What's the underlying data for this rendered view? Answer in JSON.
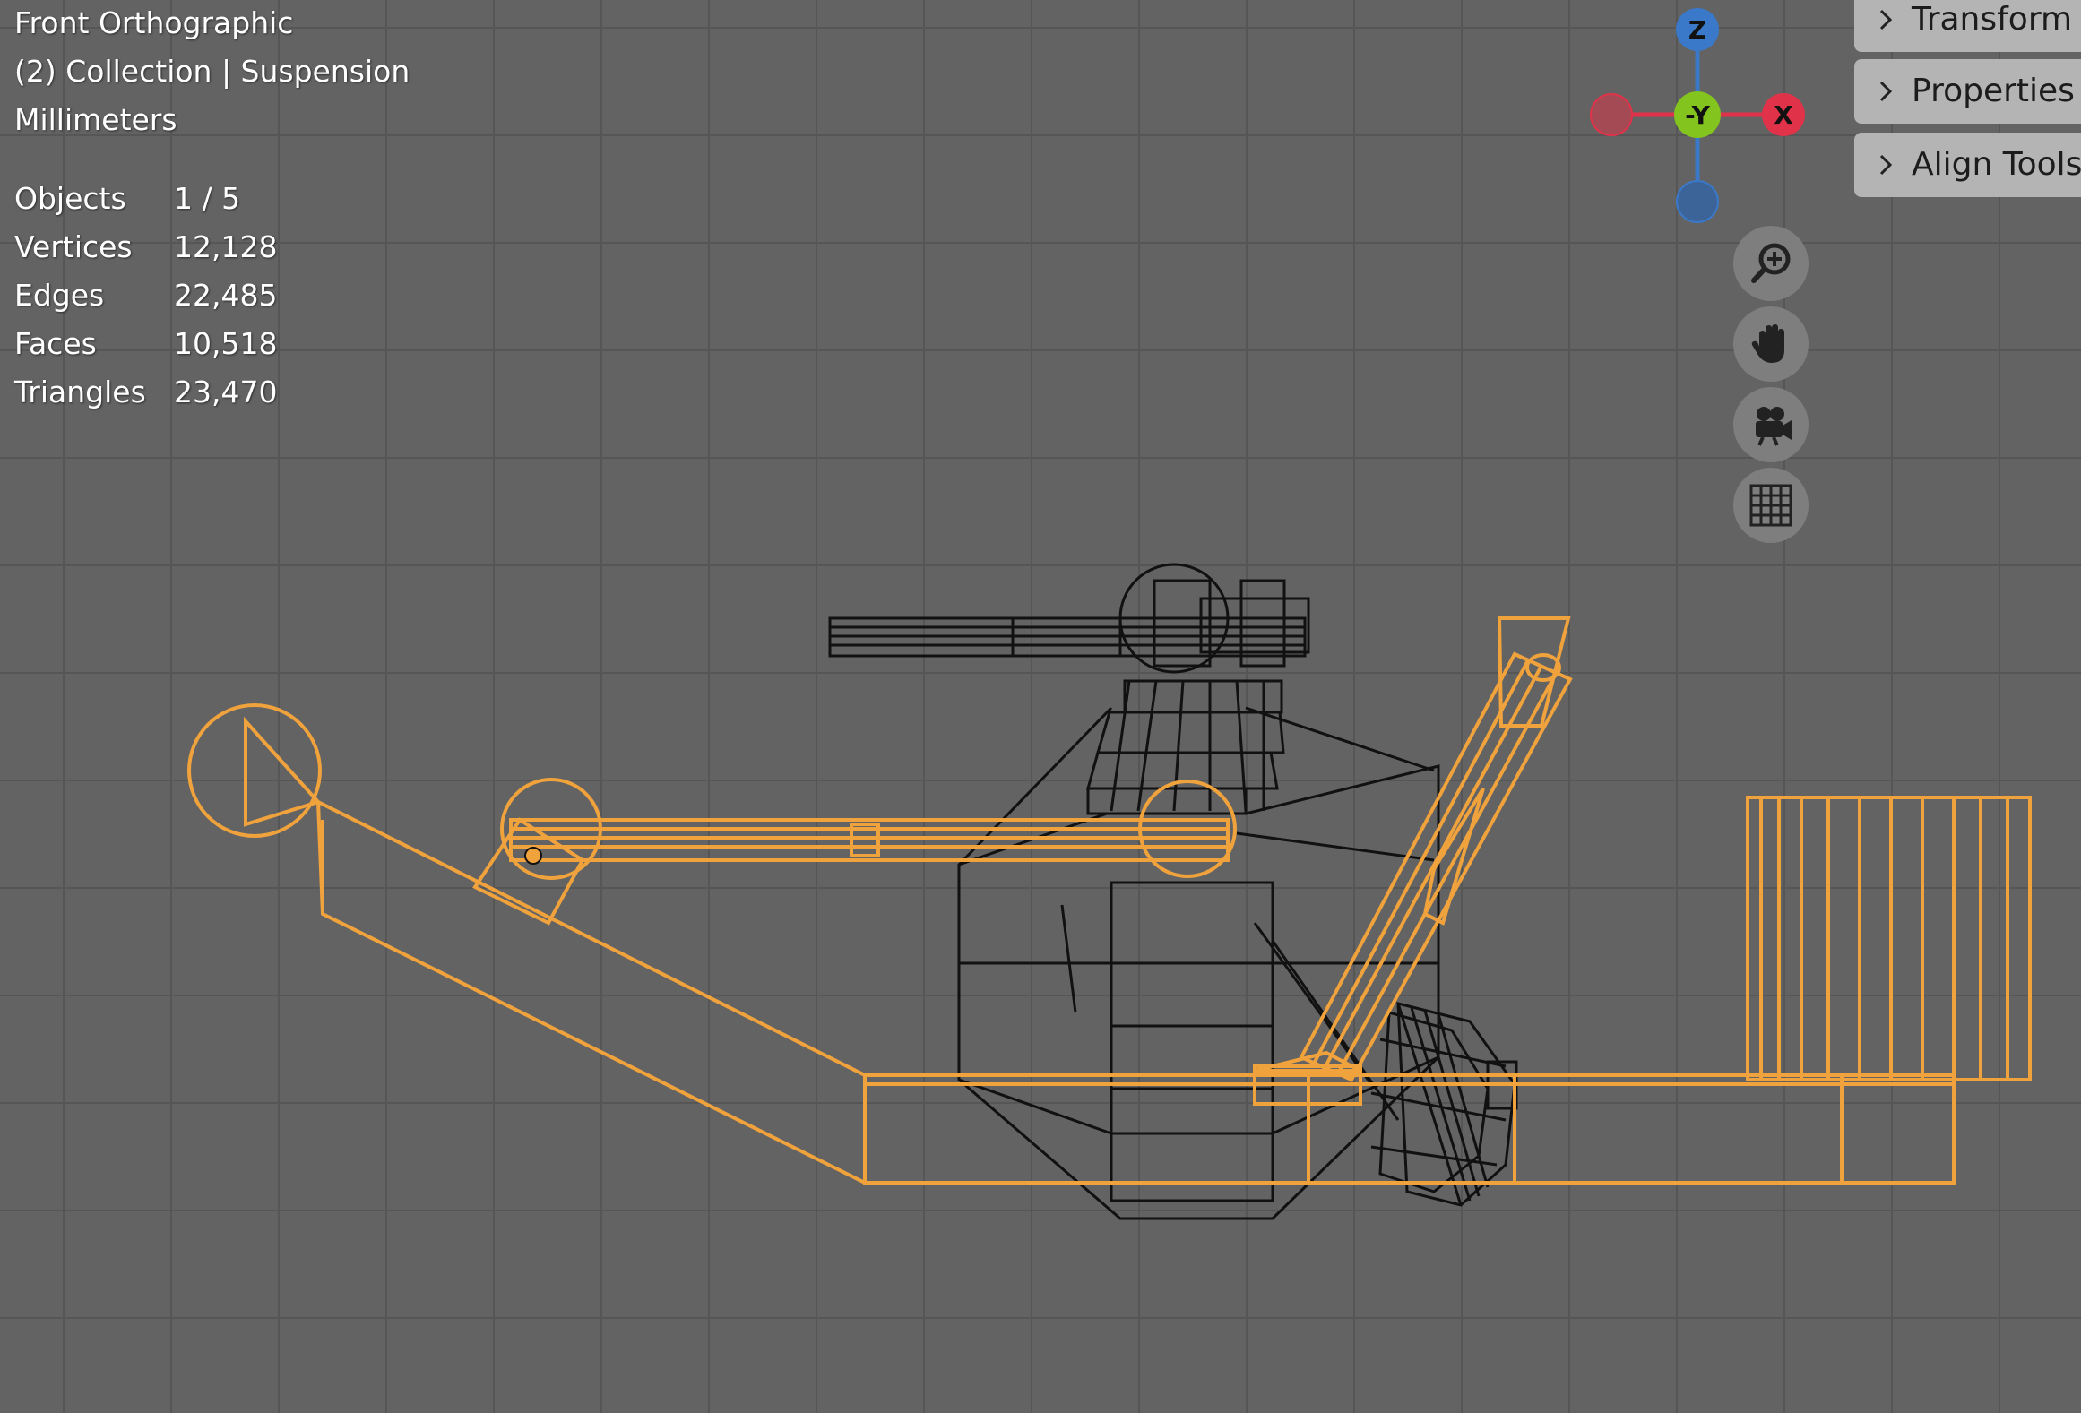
{
  "viewport": {
    "view_name": "Front Orthographic",
    "collection_info": "(2) Collection | Suspension",
    "units": "Millimeters"
  },
  "stats": [
    {
      "label": "Objects",
      "value": "1 / 5"
    },
    {
      "label": "Vertices",
      "value": "12,128"
    },
    {
      "label": "Edges",
      "value": "22,485"
    },
    {
      "label": "Faces",
      "value": "10,518"
    },
    {
      "label": "Triangles",
      "value": "23,470"
    }
  ],
  "sidebar_tabs": [
    {
      "label": "Transform"
    },
    {
      "label": "Properties"
    },
    {
      "label": "Align Tools"
    }
  ],
  "gizmo": {
    "z_label": "Z",
    "x_label": "X",
    "y_label": "-Y",
    "colors": {
      "x": "#e0334a",
      "y": "#84c41e",
      "z": "#3a79c9"
    }
  },
  "nav_buttons": [
    {
      "icon": "zoom-icon"
    },
    {
      "icon": "hand-pan-icon"
    },
    {
      "icon": "camera-icon"
    },
    {
      "icon": "grid-icon"
    }
  ],
  "colors": {
    "background": "#636363",
    "selection_orange": "#f0a23c",
    "wire_black": "#111111"
  }
}
